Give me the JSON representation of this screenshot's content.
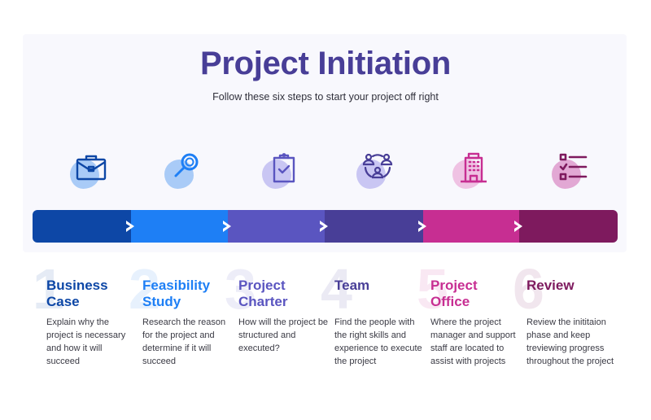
{
  "header": {
    "title": "Project Initiation",
    "subtitle": "Follow these six steps to start your project off right"
  },
  "colors": {
    "title": "#483e97",
    "panel_bg": "#f8f8fd"
  },
  "steps": [
    {
      "number": "1",
      "title_line1": "Business",
      "title_line2": "Case",
      "description": "Explain why the project is necessary and how it will succeed",
      "icon": "briefcase-icon",
      "color": "#0d47a6",
      "blob_color": "#a9cbf7"
    },
    {
      "number": "2",
      "title_line1": "Feasibility",
      "title_line2": "Study",
      "description": "Research the reason for the project and determine if it will succeed",
      "icon": "magnifier-icon",
      "color": "#1e7ff5",
      "blob_color": "#a9cbf7"
    },
    {
      "number": "3",
      "title_line1": "Project",
      "title_line2": "Charter",
      "description": "How will the project be structured and executed?",
      "icon": "clipboard-check-icon",
      "color": "#5a55c0",
      "blob_color": "#c9c6f3"
    },
    {
      "number": "4",
      "title_line1": "Team",
      "title_line2": "",
      "description": "Find the people with the right skills and experience to execute the project",
      "icon": "team-network-icon",
      "color": "#483e97",
      "blob_color": "#c9c6f3"
    },
    {
      "number": "5",
      "title_line1": "Project",
      "title_line2": "Office",
      "description": "Where the project manager and support staff are located to assist with projects",
      "icon": "office-building-icon",
      "color": "#c72e92",
      "blob_color": "#efc2e3"
    },
    {
      "number": "6",
      "title_line1": "Review",
      "title_line2": "",
      "description": "Review the inititaion phase and keep treviewing progress throughout the project",
      "icon": "checklist-icon",
      "color": "#7e1a5e",
      "blob_color": "#e2a8d4"
    }
  ]
}
